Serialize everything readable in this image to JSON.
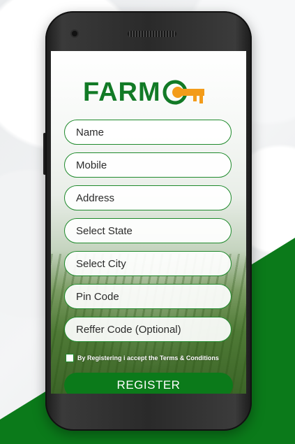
{
  "app": {
    "logo_text": "FARM",
    "brand_color": "#127a26",
    "key_color": "#f39c1a"
  },
  "form": {
    "fields": [
      {
        "placeholder": "Name",
        "value": ""
      },
      {
        "placeholder": "Mobile",
        "value": ""
      },
      {
        "placeholder": "Address",
        "value": ""
      },
      {
        "placeholder": "Select State",
        "value": ""
      },
      {
        "placeholder": "Select City",
        "value": ""
      },
      {
        "placeholder": "Pin Code",
        "value": ""
      },
      {
        "placeholder": "Reffer Code (Optional)",
        "value": ""
      }
    ],
    "terms_label": "By Registering i accept the Terms & Conditions",
    "terms_checked": false,
    "register_label": "REGISTER"
  },
  "colors": {
    "accent": "#0b7a1a",
    "field_border": "#1f8a2c"
  }
}
